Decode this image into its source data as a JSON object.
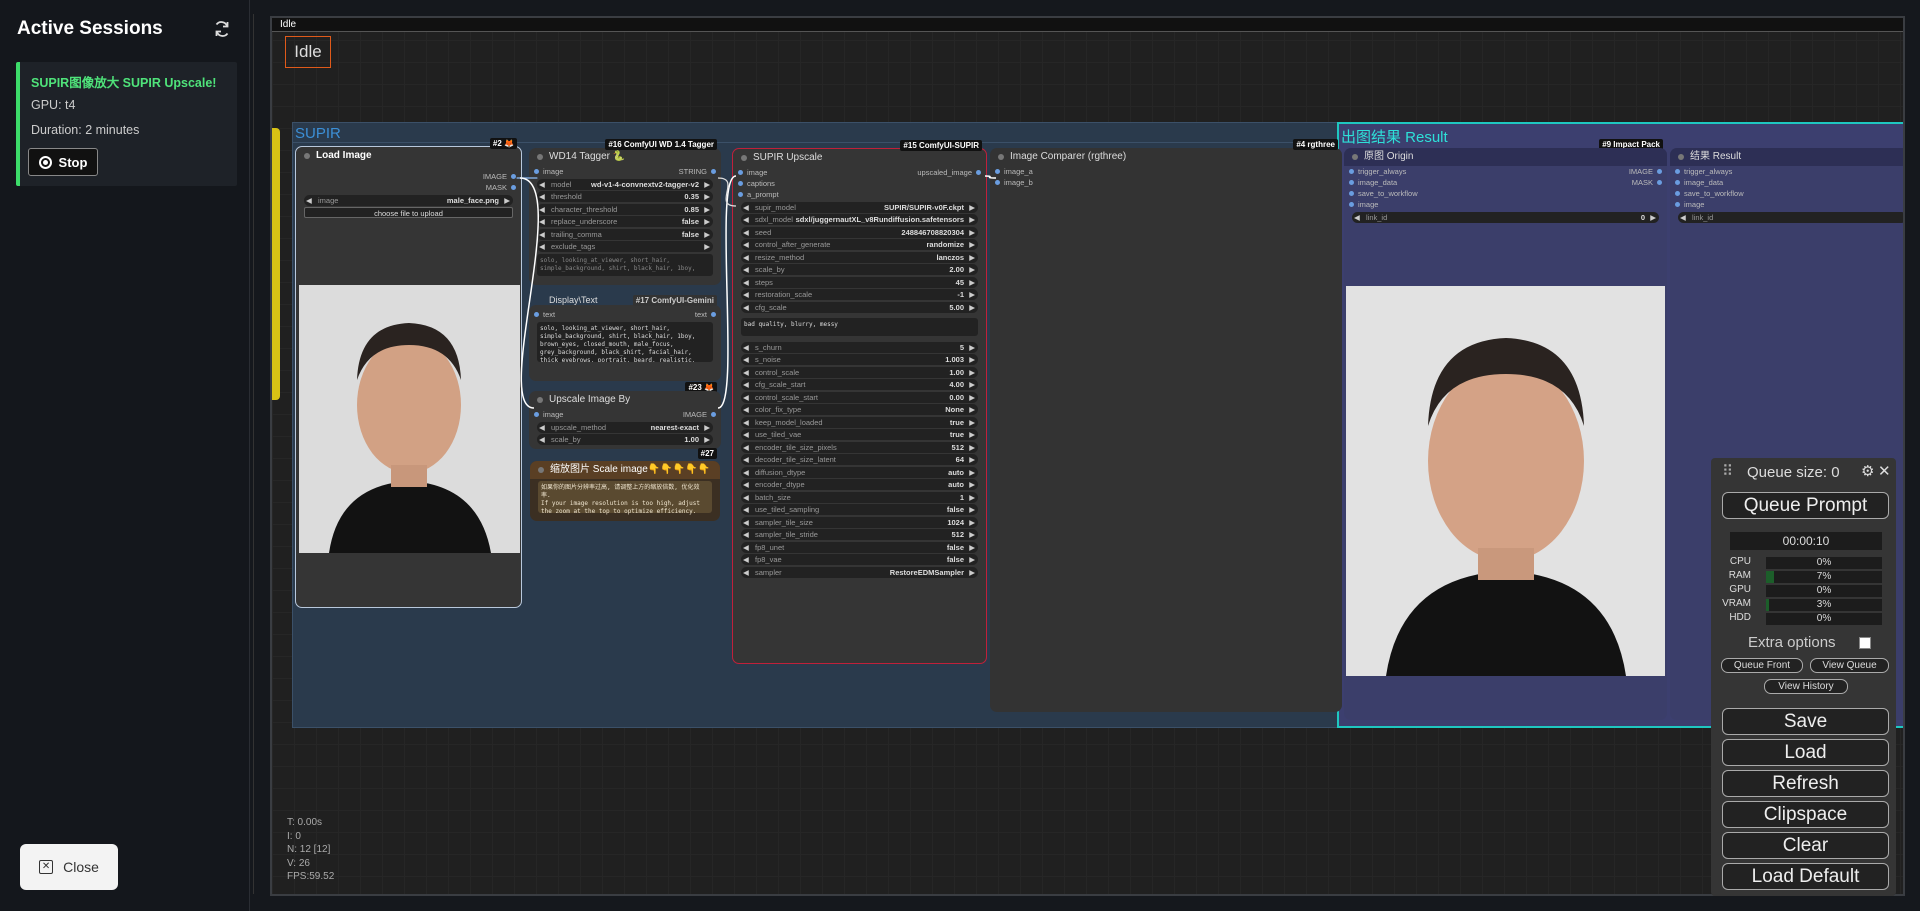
{
  "sessions": {
    "title": "Active Sessions",
    "card": {
      "name": "SUPIR图像放大 SUPIR Upscale!",
      "gpu": "GPU: t4",
      "duration": "Duration: 2 minutes",
      "stop_label": "Stop"
    },
    "close_label": "Close"
  },
  "canvas": {
    "topbar_text": "Idle",
    "status": "Idle",
    "stats": [
      "T: 0.00s",
      "I: 0",
      "N: 12 [12]",
      "V: 26",
      "FPS:59.52"
    ]
  },
  "groups": {
    "supir": "SUPIR",
    "result": "出图结果 Result"
  },
  "nodes": {
    "load_image": {
      "title": "Load Image",
      "badge": "#2 🦊",
      "out_image": "IMAGE",
      "out_mask": "MASK",
      "widget_label": "image",
      "widget_value": "male_face.png",
      "upload": "choose file to upload"
    },
    "wd14": {
      "title": "WD14 Tagger 🐍",
      "badge": "#16 ComfyUI WD 1.4 Tagger",
      "in_image": "image",
      "out": "STRING",
      "widgets": [
        {
          "label": "model",
          "value": "wd-v1-4-convnextv2-tagger-v2"
        },
        {
          "label": "threshold",
          "value": "0.35"
        },
        {
          "label": "character_threshold",
          "value": "0.85"
        },
        {
          "label": "replace_underscore",
          "value": "false"
        },
        {
          "label": "trailing_comma",
          "value": "false"
        },
        {
          "label": "exclude_tags",
          "value": ""
        }
      ],
      "preview": "solo, looking_at_viewer, short_hair, simple_background, shirt, black_hair, 1boy, "
    },
    "show_text": {
      "badge": "#17 ComfyUI-Gemini",
      "in": "text",
      "out": "text",
      "overlap": "Display\\Text",
      "text": "solo, looking_at_viewer, short_hair, simple_background, shirt, black_hair, 1boy, brown_eyes, closed_mouth, male_focus, grey_background, black_shirt, facial_hair, thick_eyebrows, portrait, beard, realistic, stubble, very_short_hair",
      "badge2": "#23 🦊"
    },
    "upscale_by": {
      "title": "Upscale Image By",
      "in": "image",
      "out": "IMAGE",
      "badge": "#27",
      "widgets": [
        {
          "label": "upscale_method",
          "value": "nearest-exact"
        },
        {
          "label": "scale_by",
          "value": "1.00"
        }
      ]
    },
    "note": {
      "title": "缩放图片 Scale image👇👇👇👇👇",
      "text1": "如果你的图片分辨率过高, 请调整上方的缩放倍数, 优化效率.",
      "text2": "If your image resolution is too high, adjust the zoom at the top to optimize efficiency."
    },
    "supir": {
      "title": "SUPIR Upscale",
      "badge": "#15 ComfyUI-SUPIR",
      "in_image": "image",
      "in_captions": "captions",
      "in_prompt": "a_prompt",
      "out": "upscaled_image",
      "widgets1": [
        {
          "label": "supir_model",
          "value": "SUPIR/SUPIR-v0F.ckpt"
        },
        {
          "label": "sdxl_model",
          "value": "sdxl/juggernautXL_v8Rundiffusion.safetensors"
        },
        {
          "label": "seed",
          "value": "248846708820304"
        },
        {
          "label": "control_after_generate",
          "value": "randomize"
        },
        {
          "label": "resize_method",
          "value": "lanczos"
        },
        {
          "label": "scale_by",
          "value": "2.00"
        },
        {
          "label": "steps",
          "value": "45"
        },
        {
          "label": "restoration_scale",
          "value": "-1"
        },
        {
          "label": "cfg_scale",
          "value": "5.00"
        }
      ],
      "neg": "bad quality, blurry, messy",
      "widgets2": [
        {
          "label": "s_churn",
          "value": "5"
        },
        {
          "label": "s_noise",
          "value": "1.003"
        },
        {
          "label": "control_scale",
          "value": "1.00"
        },
        {
          "label": "cfg_scale_start",
          "value": "4.00"
        },
        {
          "label": "control_scale_start",
          "value": "0.00"
        },
        {
          "label": "color_fix_type",
          "value": "None"
        },
        {
          "label": "keep_model_loaded",
          "value": "true"
        },
        {
          "label": "use_tiled_vae",
          "value": "true"
        },
        {
          "label": "encoder_tile_size_pixels",
          "value": "512"
        },
        {
          "label": "decoder_tile_size_latent",
          "value": "64"
        },
        {
          "label": "diffusion_dtype",
          "value": "auto"
        },
        {
          "label": "encoder_dtype",
          "value": "auto"
        },
        {
          "label": "batch_size",
          "value": "1"
        },
        {
          "label": "use_tiled_sampling",
          "value": "false"
        },
        {
          "label": "sampler_tile_size",
          "value": "1024"
        },
        {
          "label": "sampler_tile_stride",
          "value": "512"
        },
        {
          "label": "fp8_unet",
          "value": "false"
        },
        {
          "label": "fp8_vae",
          "value": "false"
        },
        {
          "label": "sampler",
          "value": "RestoreEDMSampler"
        }
      ]
    },
    "comparer": {
      "title": "Image Comparer (rgthree)",
      "badge": "#4 rgthree",
      "in_a": "image_a",
      "in_b": "image_b"
    },
    "origin": {
      "title": "原图 Origin",
      "badge": "#9 Impact Pack",
      "inputs": [
        "trigger_always",
        "image_data",
        "save_to_workflow",
        "image"
      ],
      "out_image": "IMAGE",
      "out_mask": "MASK",
      "link_label": "link_id",
      "link_value": "0"
    },
    "result": {
      "title": "结果 Result",
      "inputs": [
        "trigger_always",
        "image_data",
        "save_to_workflow",
        "image"
      ],
      "link_label": "link_id"
    }
  },
  "queue": {
    "title": "Queue size: 0",
    "queue_prompt": "Queue Prompt",
    "timer": "00:00:10",
    "stats": [
      {
        "label": "CPU",
        "value": "0%",
        "fill": 0
      },
      {
        "label": "RAM",
        "value": "7%",
        "fill": 7
      },
      {
        "label": "GPU",
        "value": "0%",
        "fill": 0
      },
      {
        "label": "VRAM",
        "value": "3%",
        "fill": 3
      },
      {
        "label": "HDD",
        "value": "0%",
        "fill": 0
      }
    ],
    "extra_options": "Extra options",
    "queue_front": "Queue Front",
    "view_queue": "View Queue",
    "view_history": "View History",
    "save": "Save",
    "load": "Load",
    "refresh": "Refresh",
    "clipspace": "Clipspace",
    "clear": "Clear",
    "load_default": "Load Default"
  },
  "colors": {
    "accent_green": "#4fe37a",
    "supir_group": "#2a3b4d",
    "result_group": "#3b3f6e",
    "result_border": "#1fc7c0"
  }
}
